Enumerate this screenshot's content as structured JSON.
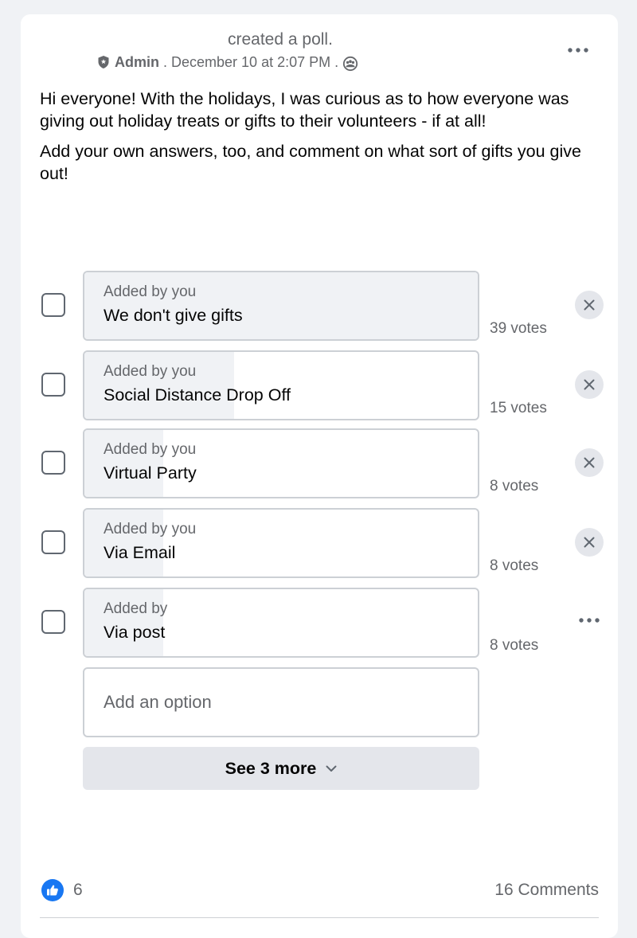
{
  "post": {
    "action_text": "created a poll.",
    "author_role": "Admin",
    "separator": ".",
    "timestamp": "December 10 at 2:07 PM",
    "paragraphs": [
      "Hi everyone! With the holidays, I was curious as to how everyone was giving out holiday treats or gifts to their volunteers - if at all!",
      "Add your own answers, too, and comment on what sort of gifts you give out!"
    ]
  },
  "poll": {
    "options": [
      {
        "added_by": "Added by you",
        "label": "We don't give gifts",
        "votes": "39 votes",
        "vote_share": 1.0
      },
      {
        "added_by": "Added by you",
        "label": "Social Distance Drop Off",
        "votes": "15 votes",
        "vote_share": 0.38
      },
      {
        "added_by": "Added by you",
        "label": "Virtual Party",
        "votes": "8 votes",
        "vote_share": 0.2
      },
      {
        "added_by": "Added by you",
        "label": "Via Email",
        "votes": "8 votes",
        "vote_share": 0.2
      },
      {
        "added_by": "Added by",
        "label": "Via post",
        "votes": "8 votes",
        "vote_share": 0.2
      }
    ],
    "add_option_placeholder": "Add an option",
    "see_more_label": "See 3 more"
  },
  "footer": {
    "likes": "6",
    "comments": "16 Comments"
  },
  "colors": {
    "like_blue": "#1877f2",
    "secondary_text": "#65676b",
    "fill_gray": "#f0f2f5"
  },
  "icons": [
    "shield-icon",
    "group-members-icon",
    "more-icon",
    "close-icon",
    "chevron-down-icon",
    "thumbs-up-icon"
  ]
}
